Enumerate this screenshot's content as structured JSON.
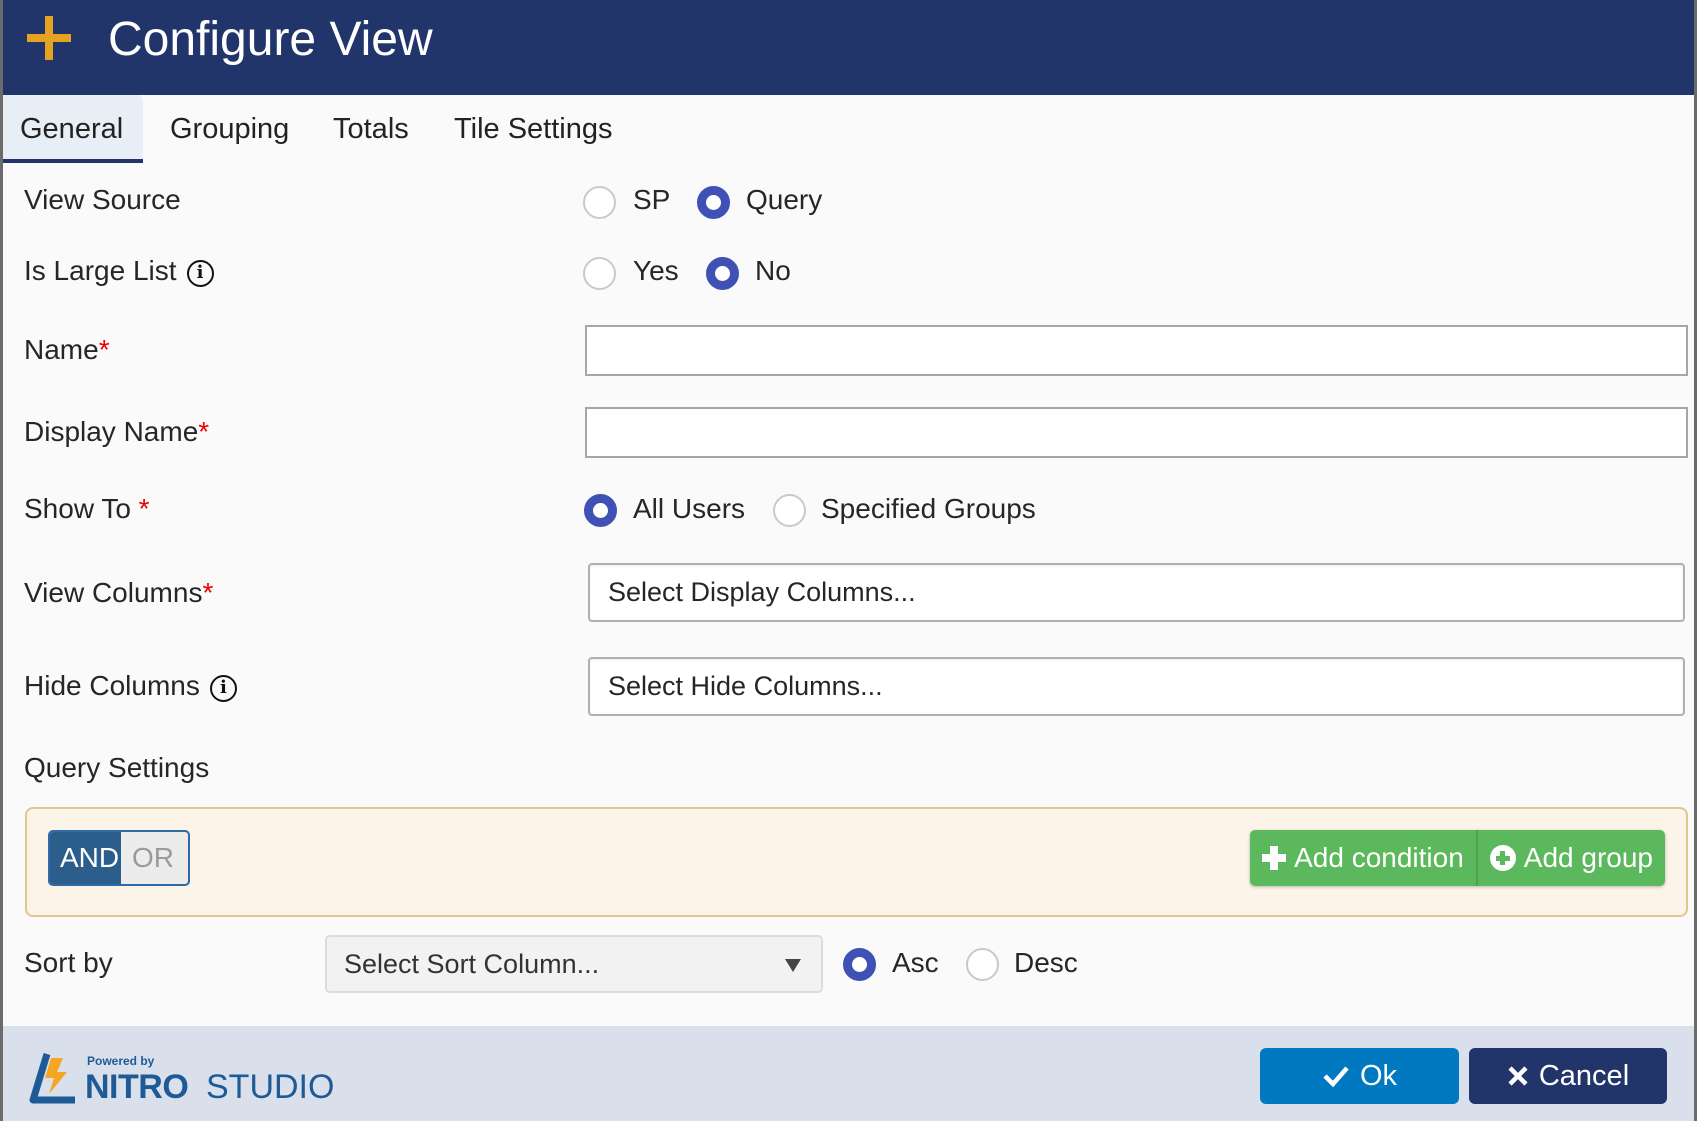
{
  "dialog": {
    "title": "Configure View",
    "title_icon": "plus-icon"
  },
  "tabs": [
    {
      "label": "General",
      "active": true
    },
    {
      "label": "Grouping",
      "active": false
    },
    {
      "label": "Totals",
      "active": false
    },
    {
      "label": "Tile Settings",
      "active": false
    }
  ],
  "form": {
    "view_source": {
      "label": "View Source",
      "options": [
        {
          "label": "SP",
          "selected": false
        },
        {
          "label": "Query",
          "selected": true
        }
      ]
    },
    "is_large_list": {
      "label": "Is Large List",
      "info_icon": "info-icon",
      "options": [
        {
          "label": "Yes",
          "selected": false
        },
        {
          "label": "No",
          "selected": true
        }
      ]
    },
    "name": {
      "label": "Name",
      "required_mark": "*",
      "value": ""
    },
    "display_name": {
      "label": "Display Name",
      "required_mark": "*",
      "value": ""
    },
    "show_to": {
      "label": "Show To ",
      "required_mark": "*",
      "options": [
        {
          "label": "All Users",
          "selected": true
        },
        {
          "label": "Specified Groups",
          "selected": false
        }
      ]
    },
    "view_columns": {
      "label": "View Columns",
      "required_mark": "*",
      "placeholder": "Select Display Columns..."
    },
    "hide_columns": {
      "label": "Hide Columns",
      "info_icon": "info-icon",
      "placeholder": "Select Hide Columns..."
    },
    "query_settings": {
      "label": "Query Settings",
      "logic_toggle": {
        "and_label": "AND",
        "or_label": "OR",
        "selected": "AND"
      },
      "add_condition_label": "Add condition",
      "add_group_label": "Add group"
    },
    "sort_by": {
      "label": "Sort by",
      "placeholder": "Select Sort Column...",
      "options": [
        {
          "label": "Asc",
          "selected": true
        },
        {
          "label": "Desc",
          "selected": false
        }
      ]
    }
  },
  "footer": {
    "logo_powered_by": "Powered by",
    "logo_nitro": "NITRO",
    "logo_studio": "STUDIO",
    "ok_label": "Ok",
    "cancel_label": "Cancel"
  },
  "colors": {
    "header_bg": "#21356b",
    "accent_plus": "#e6a322",
    "radio_selected": "#3f51b5",
    "ok_button": "#0079c1",
    "cancel_button": "#21356b",
    "add_button": "#5cb85c",
    "and_selected": "#2c5e8c",
    "query_box_bg": "#fcf4e8",
    "footer_bg": "#d9dfeb"
  }
}
